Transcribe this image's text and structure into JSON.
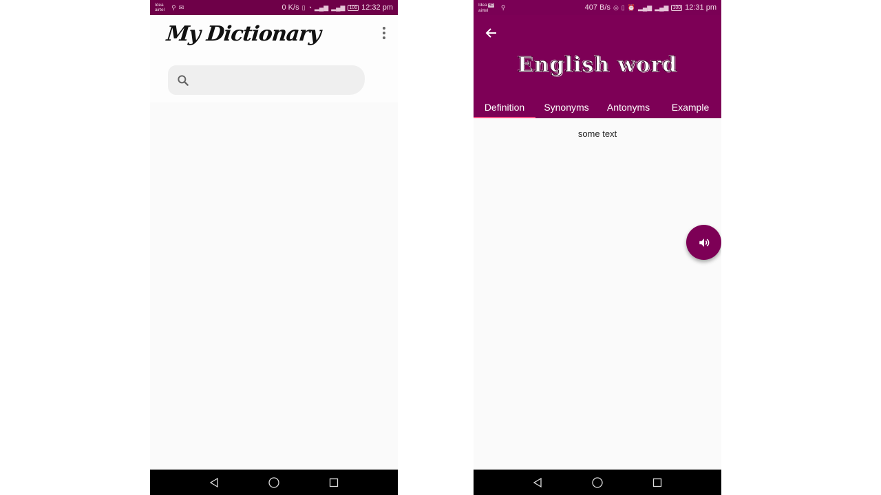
{
  "left_screen": {
    "status_bar": {
      "carrier_top": "Idea",
      "carrier_bottom": "airtel",
      "speed": "0 K/s",
      "battery": "100",
      "time": "12:32 pm"
    },
    "app_title": "My Dictionary",
    "search": {
      "icon": "search-icon",
      "placeholder": ""
    },
    "menu_icon": "more-vert-icon"
  },
  "right_screen": {
    "status_bar": {
      "carrier_top": "Idea",
      "carrier_badge": "HD",
      "carrier_bottom": "airtel",
      "speed": "407 B/s",
      "battery": "100",
      "time": "12:31 pm"
    },
    "back_icon": "arrow-back-icon",
    "word": "English word",
    "tabs": [
      {
        "label": "Definition",
        "active": true
      },
      {
        "label": "Synonyms",
        "active": false
      },
      {
        "label": "Antonyms",
        "active": false
      },
      {
        "label": "Example",
        "active": false
      }
    ],
    "content": "some text",
    "fab_icon": "volume-up-icon"
  },
  "colors": {
    "primary": "#7d0056",
    "status_bar": "#6e0048",
    "tab_indicator": "#ff4f86",
    "background": "#fafafa"
  }
}
